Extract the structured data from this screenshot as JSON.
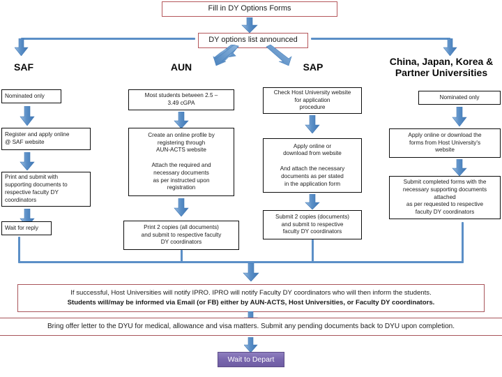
{
  "title": "DY Options Application Flowchart",
  "top": {
    "step1_label": "Fill in DY Options Forms",
    "step2_label": "DY options list announced"
  },
  "columns": [
    {
      "id": "saf",
      "heading": "SAF",
      "steps": [
        "Nominated only",
        "Register and apply online\n@ SAF website",
        "Print and submit with\nsupporting documents to\nrespective faculty DY\ncoordinators",
        "Wait for reply"
      ]
    },
    {
      "id": "aun",
      "heading": "AUN",
      "steps": [
        "Most students between 2.5 –\n3.49 cGPA",
        "Create an online profile by\nregistering through\nAUN-ACTS website\n\nAttach the required and\nnecessary documents\nas per instructed upon\nregistration",
        "Print 2 copies (all documents)\nand submit to respective faculty\nDY coordinators"
      ]
    },
    {
      "id": "sap",
      "heading": "SAP",
      "steps": [
        "Check Host University website\nfor application\nprocedure",
        "Apply online or\ndownload from website\n\nAnd attach the necessary\ndocuments as per stated\nin the application form",
        "Submit 2 copies (documents)\nand submit to respective\nfaculty DY coordinators"
      ]
    },
    {
      "id": "partners",
      "heading": "China, Japan, Korea &\nPartner Universities",
      "steps": [
        "Nominated only",
        "Apply online or download the\nforms from Host University's\nwebsite",
        "Submit completed forms with the\nnecessary supporting documents\nattached\nas per requested to respective\nfaculty DY coordinators"
      ]
    }
  ],
  "notice": {
    "line1": "If successful, Host Universities will notify IPRO. IPRO will notify Faculty DY coordinators who will then inform the students.",
    "line2": "Students will/may be informed via Email (or FB) either by AUN-ACTS, Host Universities, or Faculty DY coordinators."
  },
  "offer_letter": "Bring offer letter to the DYU for medical, allowance and visa matters. Submit any pending documents back to DYU upon completion.",
  "final_step": "Wait to Depart",
  "colors": {
    "red_border": "#b4565a",
    "black_border": "#0b0b0b",
    "arrow_blue": "#5b8fc7",
    "purple_fill": "#7a68ae",
    "text": "#1a1a1a"
  }
}
